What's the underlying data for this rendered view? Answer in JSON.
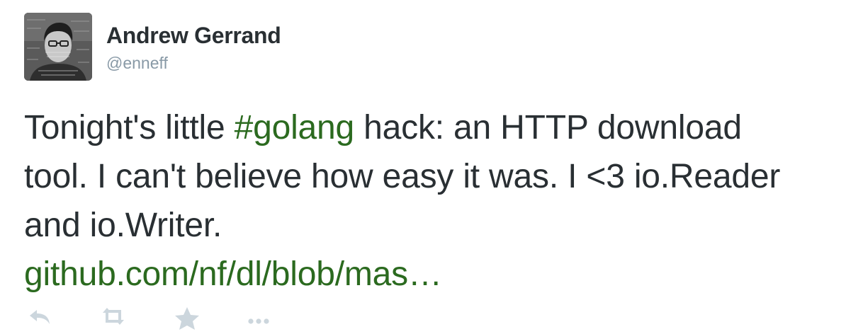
{
  "tweet": {
    "author": {
      "name": "Andrew Gerrand",
      "handle": "@enneff",
      "avatar_icon": "profile-photo"
    },
    "text": {
      "part1": "Tonight's little ",
      "hashtag": "#golang",
      "part2": " hack: an HTTP download tool. I can't believe how easy it was. I <3 io.Reader and io.Writer.",
      "link": "github.com/nf/dl/blob/mas…"
    },
    "actions": [
      {
        "icon": "reply-icon"
      },
      {
        "icon": "retweet-icon"
      },
      {
        "icon": "favorite-star-icon"
      },
      {
        "icon": "more-options-icon"
      }
    ],
    "colors": {
      "text": "#292f33",
      "handle": "#8899a6",
      "link": "#2b6a1f",
      "action_icon": "#ccd6dd"
    }
  }
}
